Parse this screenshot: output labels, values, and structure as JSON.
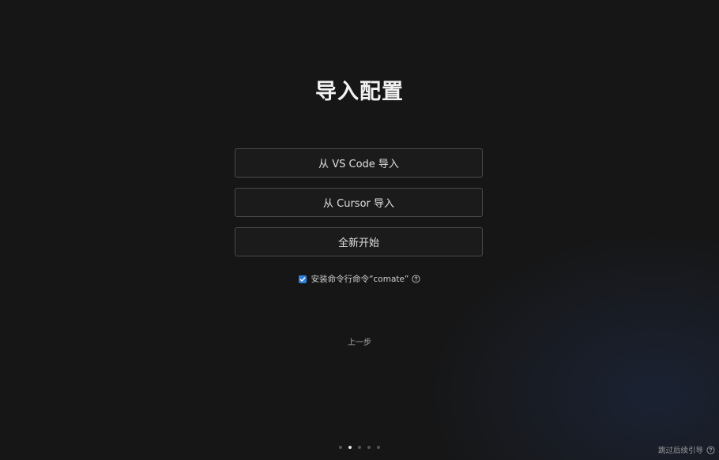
{
  "page": {
    "title": "导入配置"
  },
  "options": [
    {
      "label": "从 VS Code 导入"
    },
    {
      "label": "从 Cursor 导入"
    },
    {
      "label": "全新开始"
    }
  ],
  "cli": {
    "checked": true,
    "label": "安装命令行命令“comate”"
  },
  "nav": {
    "prev_label": "上一步",
    "skip_label": "跳过后续引导",
    "step_count": 5,
    "active_step": 2
  },
  "colors": {
    "background": "#161616",
    "accent": "#2f7fdc",
    "button_border": "#4a4a4a"
  }
}
